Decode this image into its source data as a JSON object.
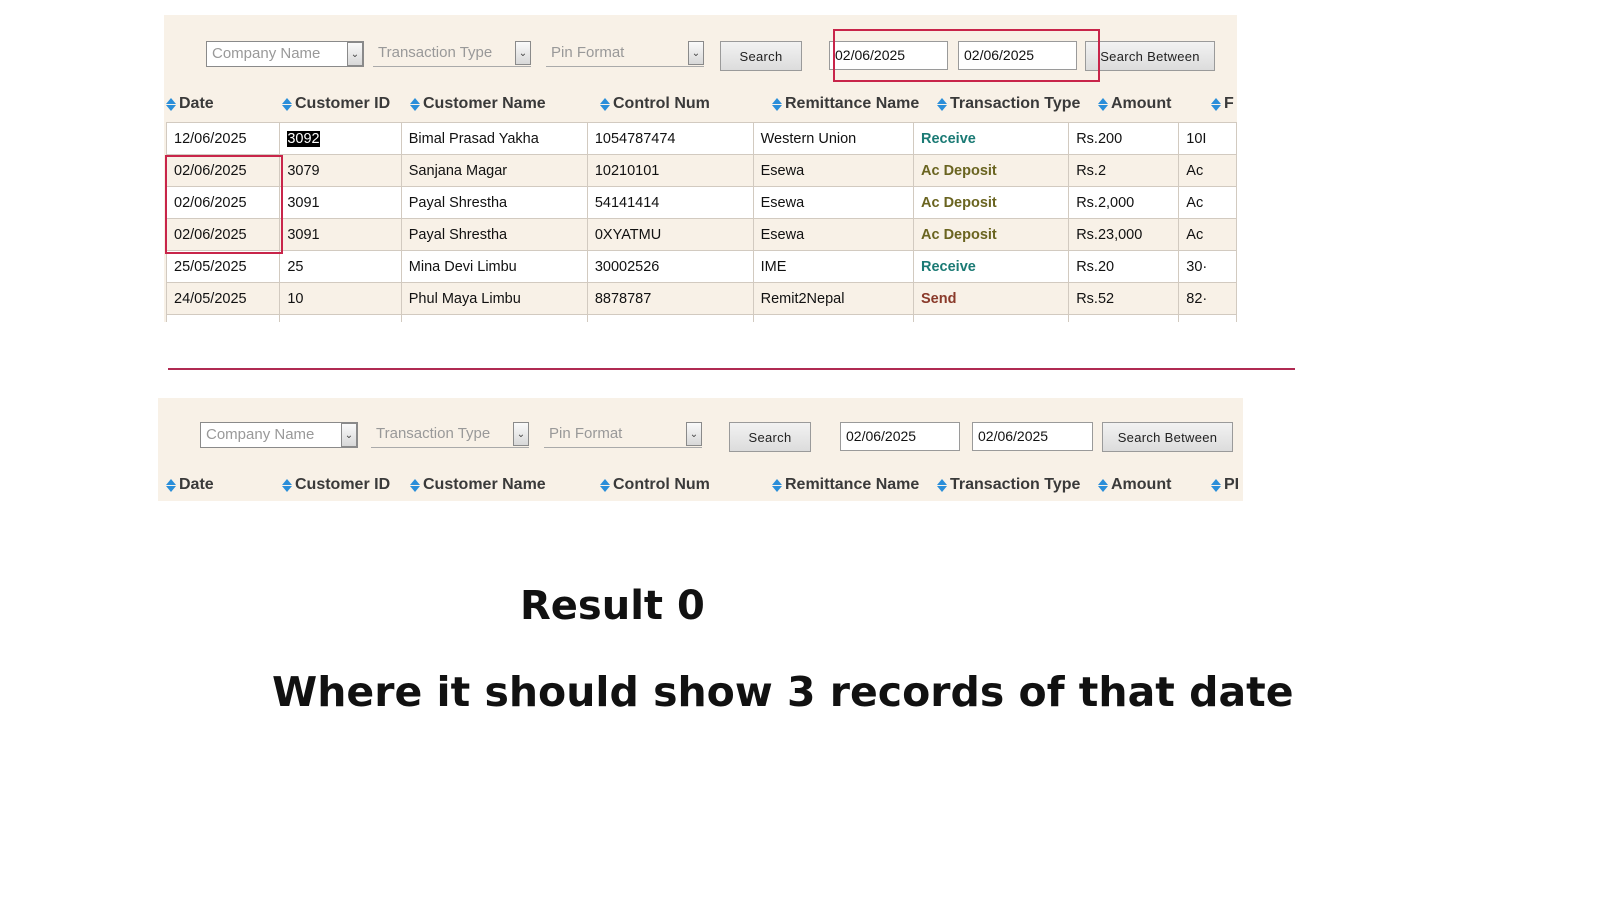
{
  "filters": {
    "company_placeholder": "Company Name",
    "type_placeholder": "Transaction Type",
    "pin_placeholder": "Pin Format",
    "search_label": "Search",
    "date_from": "02/06/2025",
    "date_to": "02/06/2025",
    "search_between_label": "Search Between"
  },
  "columns": [
    "Date",
    "Customer ID",
    "Customer Name",
    "Control Num",
    "Remittance Name",
    "Transaction Type",
    "Amount",
    "F"
  ],
  "columns_bottom_last": "PI",
  "rows": [
    {
      "date": "12/06/2025",
      "cid": "3092",
      "name": "Bimal Prasad Yakha",
      "control": "1054787474",
      "remit": "Western  Union",
      "type": "Receive",
      "amount": "Rs.200",
      "extra": "10I"
    },
    {
      "date": "02/06/2025",
      "cid": "3079",
      "name": "Sanjana Magar",
      "control": "10210101",
      "remit": "Esewa",
      "type": "Ac Deposit",
      "amount": "Rs.2",
      "extra": "Ac"
    },
    {
      "date": "02/06/2025",
      "cid": "3091",
      "name": "Payal Shrestha",
      "control": "54141414",
      "remit": "Esewa",
      "type": "Ac Deposit",
      "amount": "Rs.2,000",
      "extra": "Ac"
    },
    {
      "date": "02/06/2025",
      "cid": "3091",
      "name": "Payal Shrestha",
      "control": "0XYATMU",
      "remit": "Esewa",
      "type": "Ac Deposit",
      "amount": "Rs.23,000",
      "extra": "Ac"
    },
    {
      "date": "25/05/2025",
      "cid": "25",
      "name": "Mina Devi Limbu",
      "control": "30002526",
      "remit": "IME",
      "type": "Receive",
      "amount": "Rs.20",
      "extra": "30·"
    },
    {
      "date": "24/05/2025",
      "cid": "10",
      "name": "Phul Maya Limbu",
      "control": "8878787",
      "remit": "Remit2Nepal",
      "type": "Send",
      "amount": "Rs.52",
      "extra": "82·"
    }
  ],
  "result_text": "Result 0",
  "note_text": "Where it should show 3 records of that date",
  "colors": {
    "highlight": "#c8254a",
    "panel_bg": "#f8f1e7",
    "sort_icon": "#2a8ed9",
    "receive": "#1a7a74",
    "deposit": "#6a6420",
    "send": "#8a3a2a"
  }
}
